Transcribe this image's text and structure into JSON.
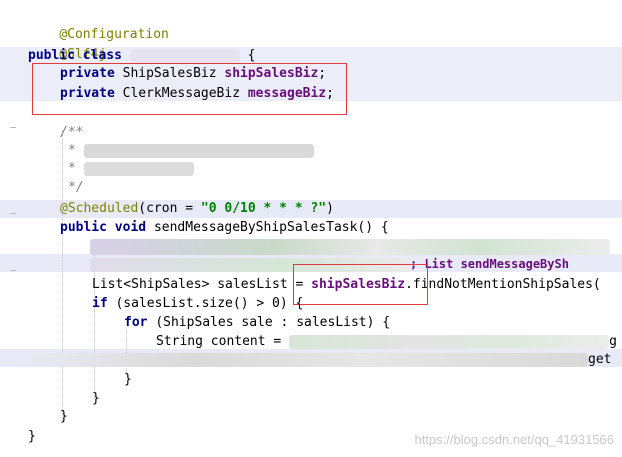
{
  "code": {
    "annotation_configuration": "@Configuration",
    "annotation_slf4j": "@Slf4j",
    "public": "public",
    "class": "class",
    "open_brace": "{",
    "close_brace": "}",
    "private": "private",
    "type_shipsalesbiz": "ShipSalesBiz",
    "field_shipsalesbiz": "shipSalesBiz",
    "type_clerkmessagebiz": "ClerkMessageBiz",
    "field_messagebiz": "messageBiz",
    "semicolon": ";",
    "comment_open": "/**",
    "comment_star": "*",
    "comment_close": "*/",
    "annotation_scheduled": "@Scheduled",
    "cron_open": "(cron = ",
    "cron_value": "\"0 0/10 * * * ?\"",
    "cron_close": ")",
    "void": "void",
    "method_signature": "sendMessageByShipSalesTask() {",
    "partial_line_tail": "; List sendMessageBySh",
    "list_decl_start": "List<ShipSales> salesList = ",
    "list_decl_call": ".findNotMentionShipSales(",
    "if": "if",
    "if_cond": "(salesList.size() > 0) {",
    "for": "for",
    "for_cond": "(ShipSales sale : salesList) {",
    "string_content": "String content = ",
    "tail_g": "g",
    "tail_get": "get"
  },
  "colors": {
    "annotation": "#808000",
    "keyword": "#000080",
    "field": "#660e7a",
    "string": "#008000",
    "highlight_box": "#e03b3b"
  },
  "watermark": "https://blog.csdn.net/qq_41931566"
}
